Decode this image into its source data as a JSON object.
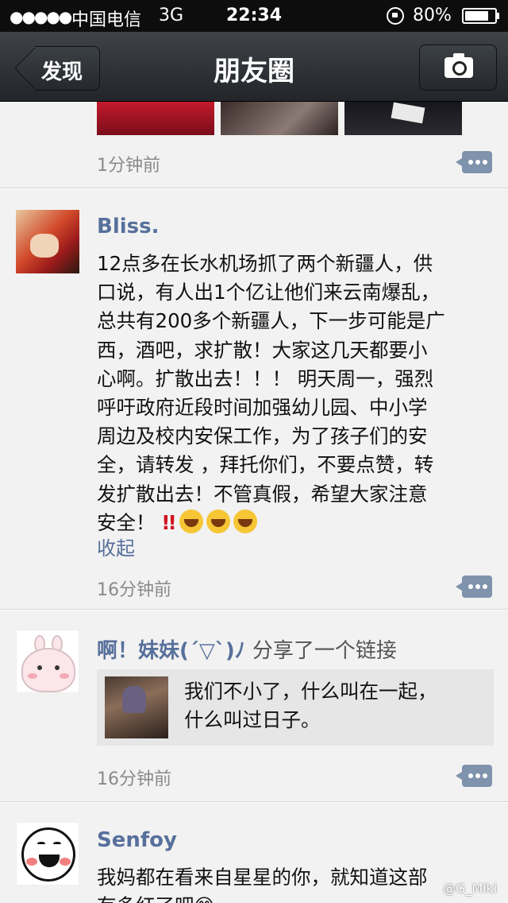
{
  "status_bar": {
    "signal": "●●●●●",
    "carrier": "中国电信",
    "network": "3G",
    "time": "22:34",
    "battery_text": "80%",
    "battery_level": 0.8
  },
  "nav": {
    "back_label": "发现",
    "title": "朋友圈",
    "camera_icon": "camera-icon"
  },
  "feed": {
    "top_post": {
      "time": "1分钟前"
    },
    "posts": [
      {
        "name": "Bliss.",
        "text_lines": [
          "12点多在长水机场抓了两个新疆人，供",
          "口说，有人出1个亿让他们来云南爆乱，",
          "总共有200多个新疆人，下一步可能是广",
          "西，酒吧，求扩散！大家这几天都要小",
          "心啊。扩散出去！！！ 明天周一，强烈",
          "呼吁政府近段时间加强幼儿园、中小学",
          "周边及校内安保工作，为了孩子们的安",
          "全，请转发 ，拜托你们，不要点赞，转",
          "发扩散出去！不管真假，希望大家注意",
          "安全！"
        ],
        "emoji": "‼️😭😭😭",
        "collapse_label": "收起",
        "time": "16分钟前"
      },
      {
        "name": "啊！妹妹(´▽`)ﾉ",
        "share_note": "分享了一个链接",
        "link_lines": [
          "我们不小了，什么叫在一起，",
          "什么叫过日子。"
        ],
        "time": "16分钟前"
      },
      {
        "name": "Senfoy",
        "text_lines": [
          "我妈都在看来自星星的你，就知道这部",
          "有多红了吧😊"
        ]
      }
    ]
  },
  "watermark": "@G_Miki"
}
